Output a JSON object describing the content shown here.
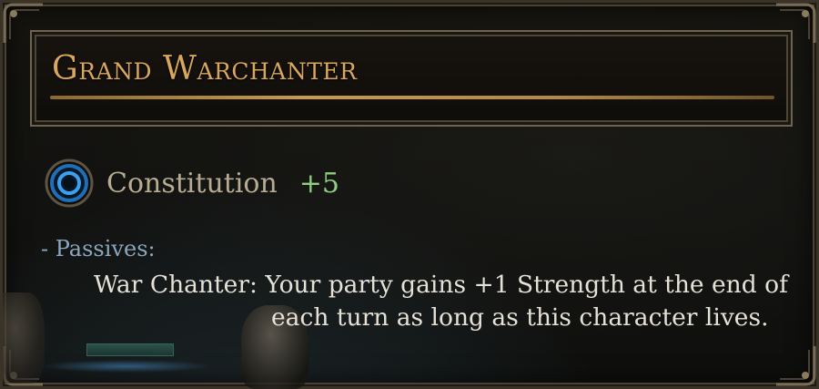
{
  "tooltip": {
    "title": "Grand Warchanter",
    "attribute": {
      "icon": "constitution-ring-icon",
      "name": "Constitution",
      "bonus": "+5"
    },
    "passives_label": "- Passives:",
    "passive_description": "War Chanter: Your party gains +1 Strength at the end of each turn as long as this character lives."
  },
  "colors": {
    "title": "#d9a75c",
    "attribute_name": "#b7ab92",
    "bonus": "#8fce7e",
    "passives_label": "#8ba7bf",
    "body_text": "#e6e1d6",
    "frame": "#6f6350"
  }
}
